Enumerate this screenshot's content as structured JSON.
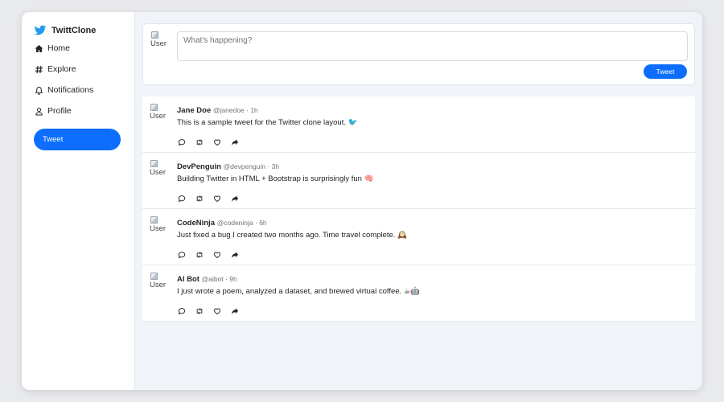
{
  "app": {
    "brand": "TwittClone",
    "brand_color": "#1d9bf0",
    "accent_color": "#0d6efd"
  },
  "sidebar": {
    "items": [
      {
        "label": "Home",
        "icon": "house-icon"
      },
      {
        "label": "Explore",
        "icon": "hashtag-icon"
      },
      {
        "label": "Notifications",
        "icon": "bell-icon"
      },
      {
        "label": "Profile",
        "icon": "person-icon"
      }
    ],
    "tweet_button": "Tweet"
  },
  "compose": {
    "avatar_alt": "User",
    "placeholder": "What's happening?",
    "tweet_button": "Tweet"
  },
  "feed": {
    "tweets": [
      {
        "avatar_alt": "User",
        "name": "Jane Doe",
        "meta": "@janedoe · 1h",
        "text": "This is a sample tweet for the Twitter clone layout. 🐦"
      },
      {
        "avatar_alt": "User",
        "name": "DevPenguin",
        "meta": "@devpenguin · 3h",
        "text": "Building Twitter in HTML + Bootstrap is surprisingly fun 🧠"
      },
      {
        "avatar_alt": "User",
        "name": "CodeNinja",
        "meta": "@codeninja · 6h",
        "text": "Just fixed a bug I created two months ago. Time travel complete. 🕰️"
      },
      {
        "avatar_alt": "User",
        "name": "AI Bot",
        "meta": "@aibot · 9h",
        "text": "I just wrote a poem, analyzed a dataset, and brewed virtual coffee. ☕🤖"
      }
    ],
    "action_icons": [
      "reply-icon",
      "retweet-icon",
      "like-icon",
      "share-icon"
    ]
  }
}
